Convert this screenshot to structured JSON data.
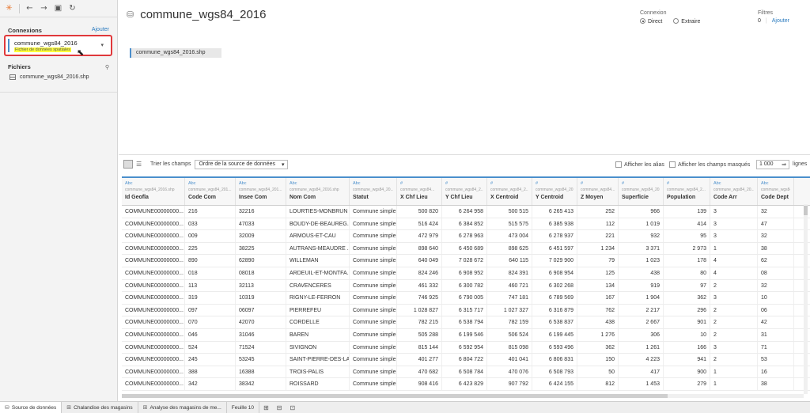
{
  "toolbar_icons": [
    "tableau-logo-icon",
    "back-arrow-icon",
    "forward-arrow-icon",
    "save-icon",
    "refresh-icon"
  ],
  "sidebar": {
    "connections_title": "Connexions",
    "add_label": "Ajouter",
    "connection_name": "commune_wgs84_2016",
    "connection_type": "Fichier de données spatiales",
    "files_title": "Fichiers",
    "file_item": "commune_wgs84_2016.shp"
  },
  "header": {
    "title": "commune_wgs84_2016",
    "connexion_label": "Connexion",
    "direct_label": "Direct",
    "extract_label": "Extraire",
    "filters_label": "Filtres",
    "filters_count": "0",
    "filters_add": "Ajouter"
  },
  "canvas": {
    "table_name": "commune_wgs84_2016.shp"
  },
  "grid_toolbar": {
    "sort_label": "Trier les champs",
    "sort_value": "Ordre de la source de données",
    "alias_label": "Afficher les alias",
    "hidden_label": "Afficher les champs masqués",
    "rows_value": "1 000",
    "rows_label": "lignes"
  },
  "columns": [
    {
      "type": "Abc",
      "source": "commune_wgs84_2016.shp",
      "name": "Id Geofla"
    },
    {
      "type": "Abc",
      "source": "commune_wgs84_201...",
      "name": "Code Com"
    },
    {
      "type": "Abc",
      "source": "commune_wgs84_201...",
      "name": "Insee Com"
    },
    {
      "type": "Abc",
      "source": "commune_wgs84_2016.shp",
      "name": "Nom Com"
    },
    {
      "type": "Abc",
      "source": "commune_wgs84_20...",
      "name": "Statut"
    },
    {
      "type": "#",
      "source": "commune_wgs84...",
      "name": "X Chf Lieu"
    },
    {
      "type": "#",
      "source": "commune_wgs84_2...",
      "name": "Y Chf Lieu"
    },
    {
      "type": "#",
      "source": "commune_wgs84_2...",
      "name": "X Centroid"
    },
    {
      "type": "#",
      "source": "commune_wgs84_201...",
      "name": "Y Centroid"
    },
    {
      "type": "#",
      "source": "commune_wgs84...",
      "name": "Z Moyen"
    },
    {
      "type": "#",
      "source": "commune_wgs84_2016...",
      "name": "Superficie"
    },
    {
      "type": "#",
      "source": "commune_wgs84_2...",
      "name": "Population"
    },
    {
      "type": "Abc",
      "source": "commune_wgs84_20...",
      "name": "Code Arr"
    },
    {
      "type": "Abc",
      "source": "commune_wgs84_20...",
      "name": "Code Dept"
    }
  ],
  "rows": [
    [
      "COMMUNE00000000...",
      "216",
      "32216",
      "LOURTIES-MONBRUN",
      "Commune simple",
      "500 820",
      "6 264 958",
      "500 515",
      "6 265 413",
      "252",
      "966",
      "139",
      "3",
      "32"
    ],
    [
      "COMMUNE00000000...",
      "033",
      "47033",
      "BOUDY-DE-BEAUREG...",
      "Commune simple",
      "516 424",
      "6 384 852",
      "515 575",
      "6 385 938",
      "112",
      "1 019",
      "414",
      "3",
      "47"
    ],
    [
      "COMMUNE00000000...",
      "009",
      "32009",
      "ARMOUS-ET-CAU",
      "Commune simple",
      "472 979",
      "6 278 963",
      "473 004",
      "6 278 937",
      "221",
      "932",
      "95",
      "3",
      "32"
    ],
    [
      "COMMUNE00000000...",
      "225",
      "38225",
      "AUTRANS-MEAUDRE ...",
      "Commune simple",
      "898 640",
      "6 450 689",
      "898 625",
      "6 451 597",
      "1 234",
      "3 371",
      "2 973",
      "1",
      "38"
    ],
    [
      "COMMUNE00000000...",
      "890",
      "62890",
      "WILLEMAN",
      "Commune simple",
      "640 049",
      "7 028 672",
      "640 115",
      "7 029 900",
      "79",
      "1 023",
      "178",
      "4",
      "62"
    ],
    [
      "COMMUNE00000000...",
      "018",
      "08018",
      "ARDEUIL-ET-MONTFA...",
      "Commune simple",
      "824 246",
      "6 908 952",
      "824 391",
      "6 908 954",
      "125",
      "438",
      "80",
      "4",
      "08"
    ],
    [
      "COMMUNE00000000...",
      "113",
      "32113",
      "CRAVENCERES",
      "Commune simple",
      "461 332",
      "6 300 782",
      "460 721",
      "6 302 268",
      "134",
      "919",
      "97",
      "2",
      "32"
    ],
    [
      "COMMUNE00000000...",
      "319",
      "10319",
      "RIGNY-LE-FERRON",
      "Commune simple",
      "746 925",
      "6 790 005",
      "747 181",
      "6 789 569",
      "167",
      "1 904",
      "362",
      "3",
      "10"
    ],
    [
      "COMMUNE00000000...",
      "097",
      "06097",
      "PIERREFEU",
      "Commune simple",
      "1 028 827",
      "6 315 717",
      "1 027 327",
      "6 316 879",
      "762",
      "2 217",
      "296",
      "2",
      "06"
    ],
    [
      "COMMUNE00000000...",
      "070",
      "42070",
      "CORDELLE",
      "Commune simple",
      "782 215",
      "6 538 794",
      "782 159",
      "6 538 837",
      "438",
      "2 667",
      "901",
      "2",
      "42"
    ],
    [
      "COMMUNE00000000...",
      "046",
      "31046",
      "BAREN",
      "Commune simple",
      "505 288",
      "6 199 546",
      "506 524",
      "6 199 445",
      "1 276",
      "306",
      "10",
      "2",
      "31"
    ],
    [
      "COMMUNE00000000...",
      "524",
      "71524",
      "SIVIGNON",
      "Commune simple",
      "815 144",
      "6 592 954",
      "815 098",
      "6 593 496",
      "362",
      "1 261",
      "166",
      "3",
      "71"
    ],
    [
      "COMMUNE00000000...",
      "245",
      "53245",
      "SAINT-PIERRE-DES-LA...",
      "Commune simple",
      "401 277",
      "6 804 722",
      "401 041",
      "6 806 831",
      "150",
      "4 223",
      "941",
      "2",
      "53"
    ],
    [
      "COMMUNE00000000...",
      "388",
      "16388",
      "TROIS-PALIS",
      "Commune simple",
      "470 682",
      "6 508 784",
      "470 076",
      "6 508 793",
      "50",
      "417",
      "900",
      "1",
      "16"
    ],
    [
      "COMMUNE00000000...",
      "342",
      "38342",
      "ROISSARD",
      "Commune simple",
      "908 416",
      "6 423 829",
      "907 792",
      "6 424 155",
      "812",
      "1 453",
      "279",
      "1",
      "38"
    ]
  ],
  "tabs": [
    {
      "label": "Source de données",
      "icon": "database-icon"
    },
    {
      "label": "Chalandise des magasins",
      "icon": "grid-icon"
    },
    {
      "label": "Analyse des magasins de me...",
      "icon": "grid-icon"
    },
    {
      "label": "Feuille 10",
      "icon": ""
    }
  ]
}
